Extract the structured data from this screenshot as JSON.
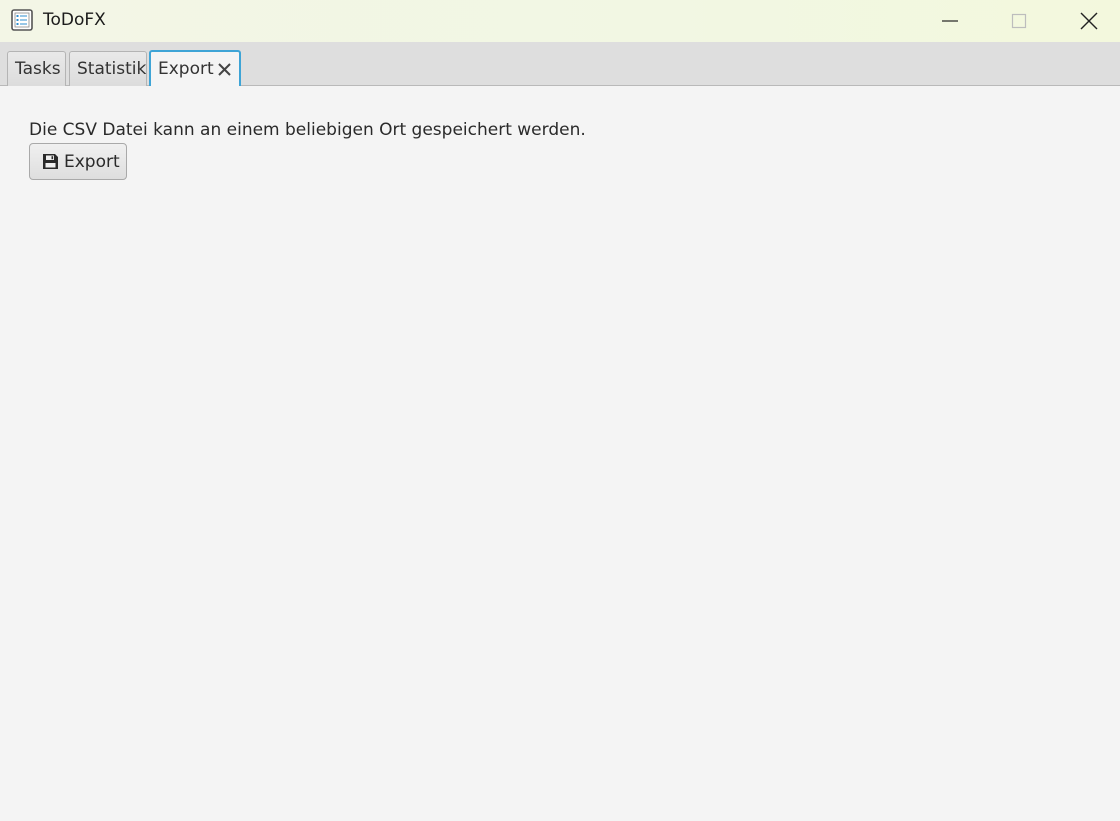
{
  "window": {
    "title": "ToDoFX"
  },
  "tabs": [
    {
      "label": "Tasks"
    },
    {
      "label": "Statistik"
    },
    {
      "label": "Export",
      "active": true,
      "closable": true
    }
  ],
  "export_page": {
    "info": "Die CSV Datei kann an einem beliebigen Ort gespeichert werden.",
    "button_label": "Export",
    "button_icon": "save-icon"
  },
  "colors": {
    "active_tab_border": "#3ea4d6",
    "background": "#f4f4f4"
  }
}
